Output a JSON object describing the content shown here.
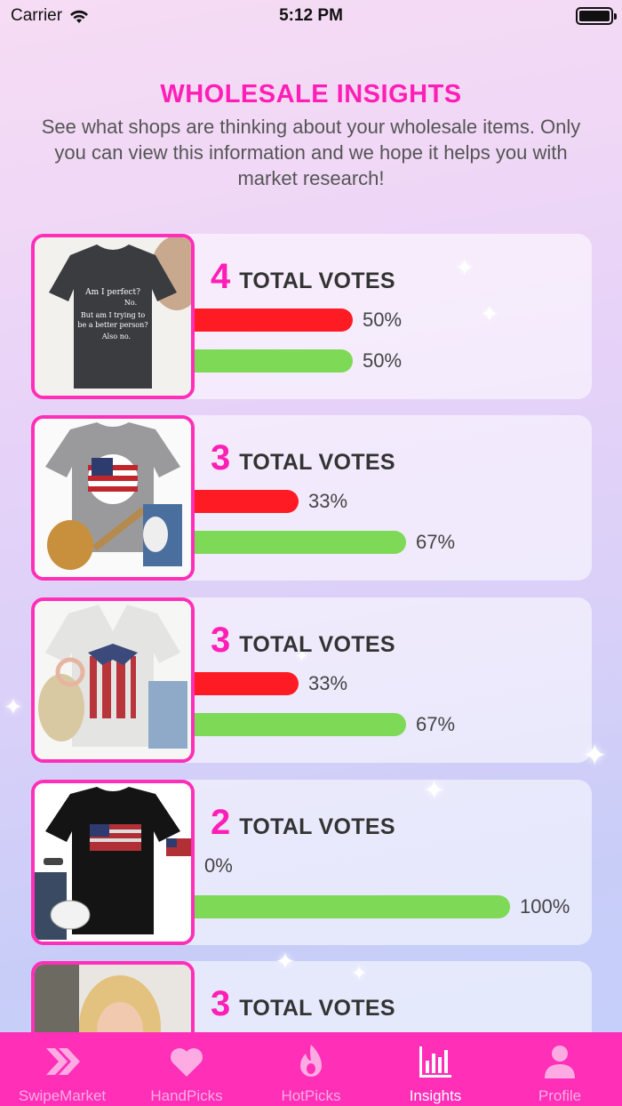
{
  "status_bar": {
    "carrier": "Carrier",
    "time": "5:12 PM"
  },
  "header": {
    "title": "WHOLESALE INSIGHTS",
    "description": "See what shops are thinking about your wholesale items. Only you can view this information and we hope it helps you with market research!"
  },
  "items": [
    {
      "votes": "4",
      "votes_label": "TOTAL VOTES",
      "no_fraction": 0.5,
      "yes_fraction": 0.5,
      "no_pct": "50%",
      "yes_pct": "50%",
      "image": "charcoal-tshirt-am-i-perfect"
    },
    {
      "votes": "3",
      "votes_label": "TOTAL VOTES",
      "no_fraction": 0.33,
      "yes_fraction": 0.67,
      "no_pct": "33%",
      "yes_pct": "67%",
      "image": "gray-tshirt-flag-baseball"
    },
    {
      "votes": "3",
      "votes_label": "TOTAL VOTES",
      "no_fraction": 0.33,
      "yes_fraction": 0.67,
      "no_pct": "33%",
      "yes_pct": "67%",
      "image": "white-tshirt-eagle-flag"
    },
    {
      "votes": "2",
      "votes_label": "TOTAL VOTES",
      "no_fraction": 0,
      "yes_fraction": 1,
      "no_pct": "0%",
      "yes_pct": "100%",
      "image": "black-tshirt-flag"
    },
    {
      "votes": "3",
      "votes_label": "TOTAL VOTES",
      "image": "model-photo"
    }
  ],
  "tab_bar": {
    "tabs": [
      {
        "label": "SwipeMarket",
        "icon": "double-chevron-icon",
        "active": false
      },
      {
        "label": "HandPicks",
        "icon": "heart-icon",
        "active": false
      },
      {
        "label": "HotPicks",
        "icon": "flame-icon",
        "active": false
      },
      {
        "label": "Insights",
        "icon": "bar-chart-icon",
        "active": true
      },
      {
        "label": "Profile",
        "icon": "person-icon",
        "active": false
      }
    ]
  },
  "colors": {
    "accent": "#ff2fb8",
    "no_bar": "#ff1b23",
    "yes_bar": "#7ed957"
  }
}
